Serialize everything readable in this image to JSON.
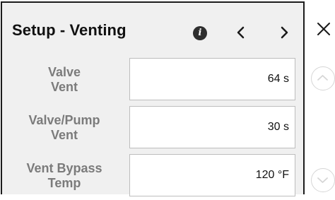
{
  "header": {
    "title": "Setup - Venting",
    "info_icon": "info-icon",
    "prev_icon": "chevron-left-icon",
    "next_icon": "chevron-right-icon",
    "close_icon": "close-icon"
  },
  "settings": [
    {
      "label_line1": "Valve",
      "label_line2": "Vent",
      "value": "64 s"
    },
    {
      "label_line1": "Valve/Pump",
      "label_line2": "Vent",
      "value": "30 s"
    },
    {
      "label_line1": "Vent Bypass",
      "label_line2": "Temp",
      "value": "120 °F"
    }
  ],
  "scroll": {
    "up_icon": "chevron-up-icon",
    "down_icon": "chevron-down-icon"
  },
  "colors": {
    "panel_bg": "#f0f0f0",
    "label_text": "#7b7b7b",
    "border": "#1c1c1c"
  }
}
